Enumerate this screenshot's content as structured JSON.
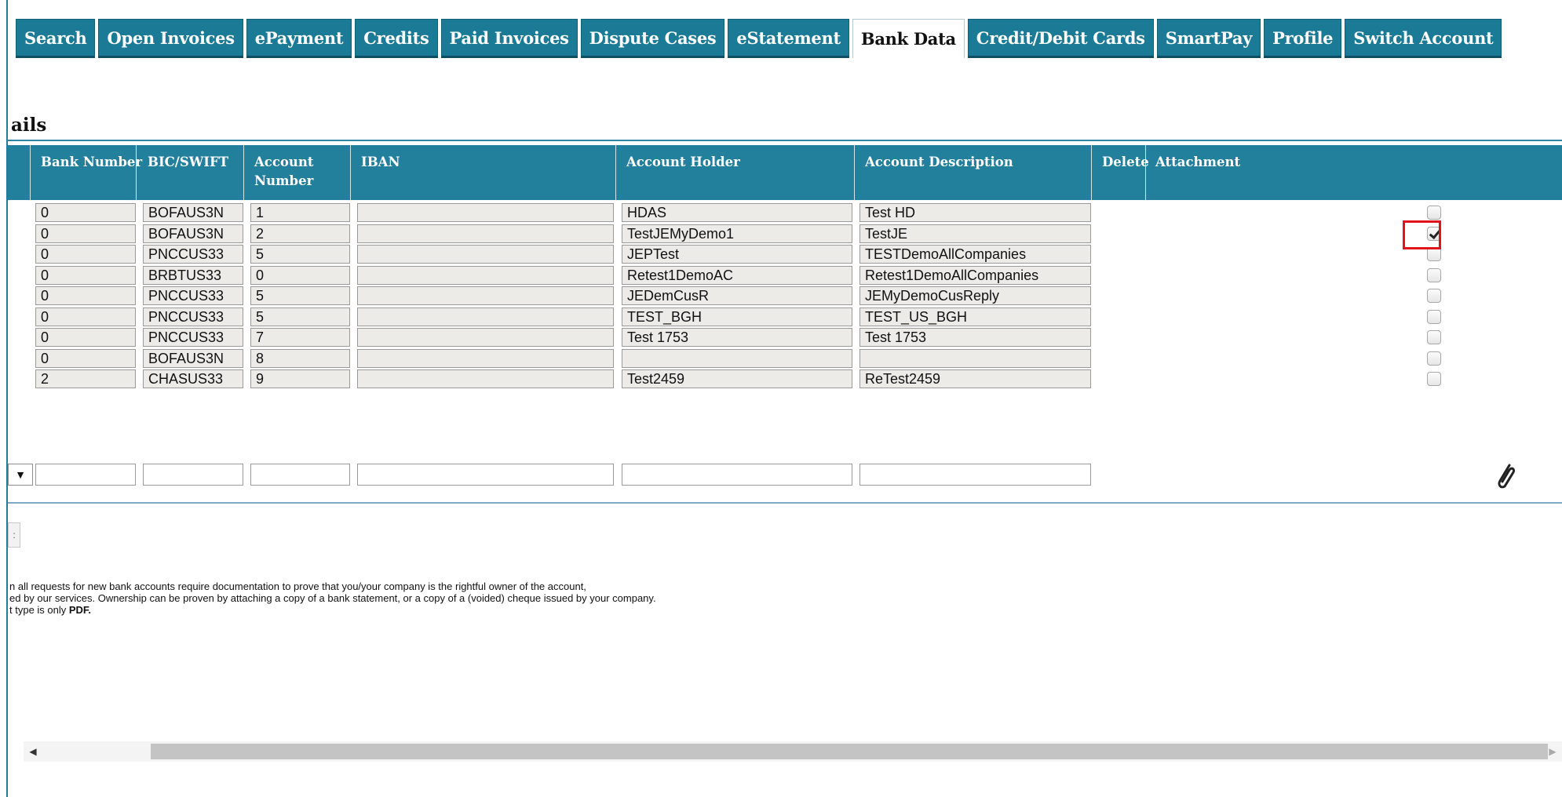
{
  "tabs": [
    {
      "label": "Search"
    },
    {
      "label": "Open Invoices"
    },
    {
      "label": "ePayment"
    },
    {
      "label": "Credits"
    },
    {
      "label": "Paid Invoices"
    },
    {
      "label": "Dispute Cases"
    },
    {
      "label": "eStatement"
    },
    {
      "label": "Bank Data",
      "active": true
    },
    {
      "label": "Credit/Debit Cards"
    },
    {
      "label": "SmartPay"
    },
    {
      "label": "Profile"
    },
    {
      "label": "Switch Account"
    }
  ],
  "section_title": "ails",
  "table": {
    "headers": {
      "bank_number": "Bank Number",
      "bic_swift": "BIC/SWIFT",
      "account_number_1": "Account",
      "account_number_2": "Number",
      "iban": "IBAN",
      "account_holder": "Account Holder",
      "account_description": "Account Description",
      "delete": "Delete",
      "attachment": "Attachment"
    },
    "rows": [
      {
        "bank_number": "0",
        "bic": "BOFAUS3N",
        "account": "1",
        "iban": "",
        "holder": "HDAS",
        "description": "Test HD",
        "delete": false
      },
      {
        "bank_number": "0",
        "bic": "BOFAUS3N",
        "account": "2",
        "iban": "",
        "holder": "TestJEMyDemo1",
        "description": "TestJE",
        "delete": true
      },
      {
        "bank_number": "0",
        "bic": "PNCCUS33",
        "account": "5",
        "iban": "",
        "holder": "JEPTest",
        "description": "TESTDemoAllCompanies",
        "delete": false
      },
      {
        "bank_number": "0",
        "bic": "BRBTUS33",
        "account": "0",
        "iban": "",
        "holder": "Retest1DemoAC",
        "description": "Retest1DemoAllCompanies",
        "delete": false
      },
      {
        "bank_number": "0",
        "bic": "PNCCUS33",
        "account": "5",
        "iban": "",
        "holder": "JEDemCusR",
        "description": "JEMyDemoCusReply",
        "delete": false
      },
      {
        "bank_number": "0",
        "bic": "PNCCUS33",
        "account": "5",
        "iban": "",
        "holder": "TEST_BGH",
        "description": "TEST_US_BGH",
        "delete": false
      },
      {
        "bank_number": "0",
        "bic": "PNCCUS33",
        "account": "7",
        "iban": "",
        "holder": "Test 1753",
        "description": "Test 1753",
        "delete": false
      },
      {
        "bank_number": "0",
        "bic": "BOFAUS3N",
        "account": "8",
        "iban": "",
        "holder": "",
        "description": "",
        "delete": false
      },
      {
        "bank_number": "2",
        "bic": "CHASUS33",
        "account": "9",
        "iban": "",
        "holder": "Test2459",
        "description": "ReTest2459",
        "delete": false
      }
    ],
    "new_row_select_symbol": "▼",
    "attachment_icon": "paperclip-icon"
  },
  "stub_button_label": ":",
  "notes": {
    "line1": "n all requests for new bank accounts require documentation to prove that you/your company is the rightful owner of the account,",
    "line2": "ed by our services. Ownership can be proven by attaching a copy of a bank statement, or a copy of a (voided) cheque issued by your company.",
    "line3_prefix": "t type is only ",
    "line3_bold": "PDF."
  },
  "scrollbar": {
    "left_arrow": "◀",
    "right_arrow": "▶"
  },
  "colors": {
    "tab_bg": "#1b7a95",
    "header_bg": "#22809d",
    "highlight": "#e0141b"
  }
}
